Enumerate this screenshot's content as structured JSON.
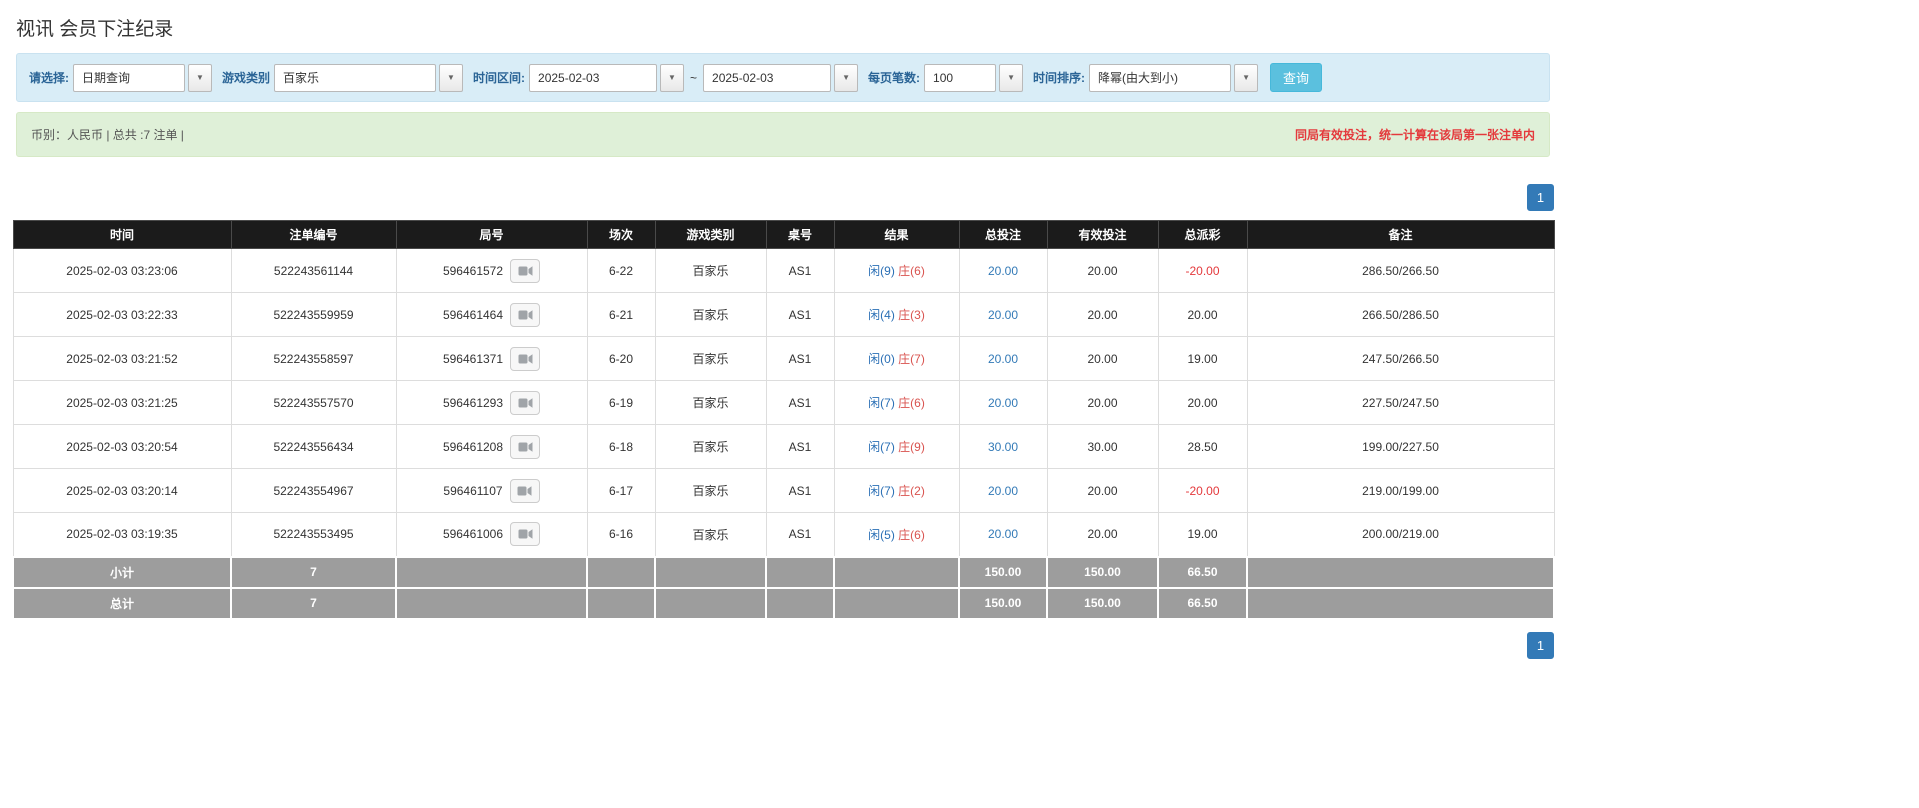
{
  "page": {
    "title": "视讯 会员下注纪录"
  },
  "icons": {
    "caret_down": "▼"
  },
  "filters": {
    "select_label": "请选择:",
    "select_value": "日期查询",
    "game_label": "游戏类别",
    "game_value": "百家乐",
    "range_label": "时间区间:",
    "range_from": "2025-02-03",
    "range_separator": "~",
    "range_to": "2025-02-03",
    "per_page_label": "每页笔数:",
    "per_page_value": "100",
    "sort_label": "时间排序:",
    "sort_value": "降幂(由大到小)",
    "search_button": "查询"
  },
  "summary": {
    "left": "币别：人民币 | 总共 :7 注单 |",
    "right": "同局有效投注，统一计算在该局第一张注单内"
  },
  "pagination": {
    "page": "1"
  },
  "table": {
    "headers": [
      "时间",
      "注单编号",
      "局号",
      "场次",
      "游戏类别",
      "桌号",
      "结果",
      "总投注",
      "有效投注",
      "总派彩",
      "备注"
    ],
    "rows": [
      {
        "time": "2025-02-03 03:23:06",
        "bet_id": "522243561144",
        "round": "596461572",
        "session": "6-22",
        "game": "百家乐",
        "table_no": "AS1",
        "result_player": "闲(9)",
        "result_banker": "庄(6)",
        "total_bet": "20.00",
        "valid_bet": "20.00",
        "payout": "-20.00",
        "note": "286.50/266.50"
      },
      {
        "time": "2025-02-03 03:22:33",
        "bet_id": "522243559959",
        "round": "596461464",
        "session": "6-21",
        "game": "百家乐",
        "table_no": "AS1",
        "result_player": "闲(4)",
        "result_banker": "庄(3)",
        "total_bet": "20.00",
        "valid_bet": "20.00",
        "payout": "20.00",
        "note": "266.50/286.50"
      },
      {
        "time": "2025-02-03 03:21:52",
        "bet_id": "522243558597",
        "round": "596461371",
        "session": "6-20",
        "game": "百家乐",
        "table_no": "AS1",
        "result_player": "闲(0)",
        "result_banker": "庄(7)",
        "total_bet": "20.00",
        "valid_bet": "20.00",
        "payout": "19.00",
        "note": "247.50/266.50"
      },
      {
        "time": "2025-02-03 03:21:25",
        "bet_id": "522243557570",
        "round": "596461293",
        "session": "6-19",
        "game": "百家乐",
        "table_no": "AS1",
        "result_player": "闲(7)",
        "result_banker": "庄(6)",
        "total_bet": "20.00",
        "valid_bet": "20.00",
        "payout": "20.00",
        "note": "227.50/247.50"
      },
      {
        "time": "2025-02-03 03:20:54",
        "bet_id": "522243556434",
        "round": "596461208",
        "session": "6-18",
        "game": "百家乐",
        "table_no": "AS1",
        "result_player": "闲(7)",
        "result_banker": "庄(9)",
        "total_bet": "30.00",
        "valid_bet": "30.00",
        "payout": "28.50",
        "note": "199.00/227.50"
      },
      {
        "time": "2025-02-03 03:20:14",
        "bet_id": "522243554967",
        "round": "596461107",
        "session": "6-17",
        "game": "百家乐",
        "table_no": "AS1",
        "result_player": "闲(7)",
        "result_banker": "庄(2)",
        "total_bet": "20.00",
        "valid_bet": "20.00",
        "payout": "-20.00",
        "note": "219.00/199.00"
      },
      {
        "time": "2025-02-03 03:19:35",
        "bet_id": "522243553495",
        "round": "596461006",
        "session": "6-16",
        "game": "百家乐",
        "table_no": "AS1",
        "result_player": "闲(5)",
        "result_banker": "庄(6)",
        "total_bet": "20.00",
        "valid_bet": "20.00",
        "payout": "19.00",
        "note": "200.00/219.00"
      }
    ],
    "subtotal": {
      "label": "小计",
      "count": "7",
      "total_bet": "150.00",
      "valid_bet": "150.00",
      "payout": "66.50"
    },
    "total": {
      "label": "总计",
      "count": "7",
      "total_bet": "150.00",
      "valid_bet": "150.00",
      "payout": "66.50"
    }
  }
}
